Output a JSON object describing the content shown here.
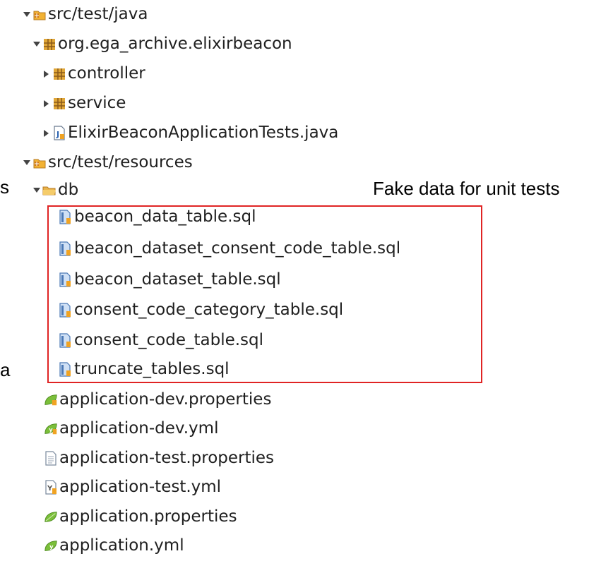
{
  "tree": {
    "rows": [
      {
        "label": "src/test/java",
        "expanded": true,
        "icon": "source-folder-icon"
      },
      {
        "label": "org.ega_archive.elixirbeacon",
        "expanded": true,
        "icon": "package-icon"
      },
      {
        "label": "controller",
        "expanded": false,
        "icon": "package-icon"
      },
      {
        "label": "service",
        "expanded": false,
        "icon": "package-icon"
      },
      {
        "label": "ElixirBeaconApplicationTests.java",
        "expanded": false,
        "icon": "java-file-icon"
      },
      {
        "label": "src/test/resources",
        "expanded": true,
        "icon": "source-folder-icon"
      },
      {
        "label": "db",
        "expanded": true,
        "icon": "folder-icon"
      },
      {
        "label": "beacon_data_table.sql",
        "icon": "sql-file-icon"
      },
      {
        "label": "beacon_dataset_consent_code_table.sql",
        "icon": "sql-file-icon"
      },
      {
        "label": "beacon_dataset_table.sql",
        "icon": "sql-file-icon"
      },
      {
        "label": "consent_code_category_table.sql",
        "icon": "sql-file-icon"
      },
      {
        "label": "consent_code_table.sql",
        "icon": "sql-file-icon"
      },
      {
        "label": "truncate_tables.sql",
        "icon": "sql-file-icon"
      },
      {
        "label": "application-dev.properties",
        "icon": "spring-properties-icon"
      },
      {
        "label": "application-dev.yml",
        "icon": "spring-yml-icon"
      },
      {
        "label": "application-test.properties",
        "icon": "text-file-icon"
      },
      {
        "label": "application-test.yml",
        "icon": "yml-file-icon"
      },
      {
        "label": "application.properties",
        "icon": "spring-leaf-icon"
      },
      {
        "label": "application.yml",
        "icon": "spring-yml-icon"
      }
    ]
  },
  "annotation": {
    "text": "Fake data for unit tests",
    "color": "#e02424"
  },
  "left_edge": {
    "glyph_1": "s",
    "glyph_2": "a"
  }
}
